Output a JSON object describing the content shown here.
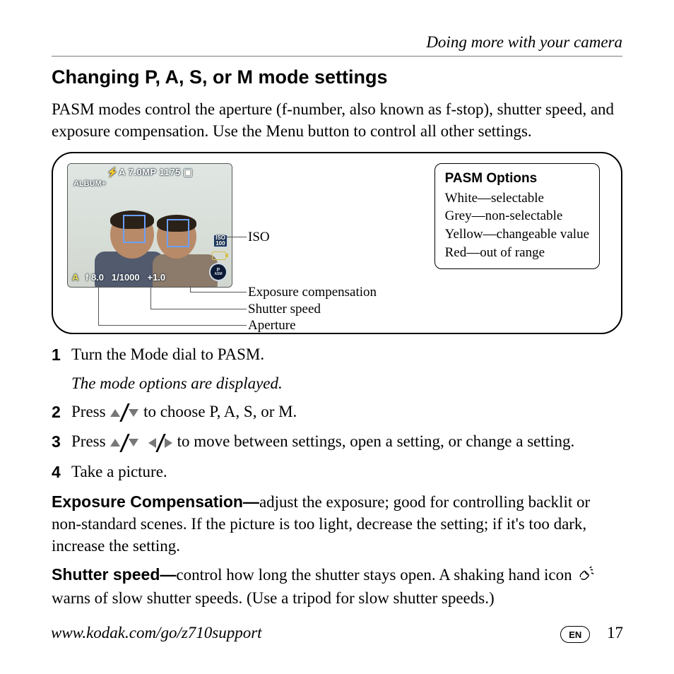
{
  "header": {
    "running": "Doing more with your camera"
  },
  "section": {
    "title": "Changing P, A, S, or M mode settings",
    "intro": "PASM modes control the aperture (f-number, also known as f-stop), shutter speed, and exposure compensation. Use the Menu button to control all other settings."
  },
  "lcd": {
    "top_line": "⚡A  7.0MP  1175 ▣",
    "album": "ALBUM+",
    "iso_label": "ISO",
    "iso_value": "100",
    "asm_top": "P",
    "asm_bottom": "ASM",
    "mode_letter": "A",
    "aperture": "f 8.0",
    "shutter": "1/1000",
    "ev": "+1.0"
  },
  "callouts": {
    "iso": "ISO",
    "ec": "Exposure compensation",
    "ss": "Shutter speed",
    "ap": "Aperture"
  },
  "pasm": {
    "title": "PASM Options",
    "white": "White—selectable",
    "grey": "Grey—non-selectable",
    "yellow": "Yellow—changeable value",
    "red": "Red—out of range"
  },
  "steps": {
    "s1": "Turn the Mode dial to PASM.",
    "s1_sub": "The mode options are displayed.",
    "s2a": "Press ",
    "s2b": " to choose P, A, S, or M.",
    "s3a": "Press ",
    "s3b": " to move between settings, open a setting, or change a setting.",
    "s4": "Take a picture."
  },
  "defs": {
    "ec_term": "Exposure Compensation—",
    "ec_body": "adjust the exposure; good for controlling backlit or non-standard scenes. If the picture is too light, decrease the setting; if it's too dark, increase the setting.",
    "ss_term": "Shutter speed—",
    "ss_body_a": "control how long the shutter stays open. A shaking hand icon ",
    "ss_body_b": " warns of slow shutter speeds. (Use a tripod for slow shutter speeds.)"
  },
  "footer": {
    "url": "www.kodak.com/go/z710support",
    "lang": "EN",
    "page": "17"
  }
}
